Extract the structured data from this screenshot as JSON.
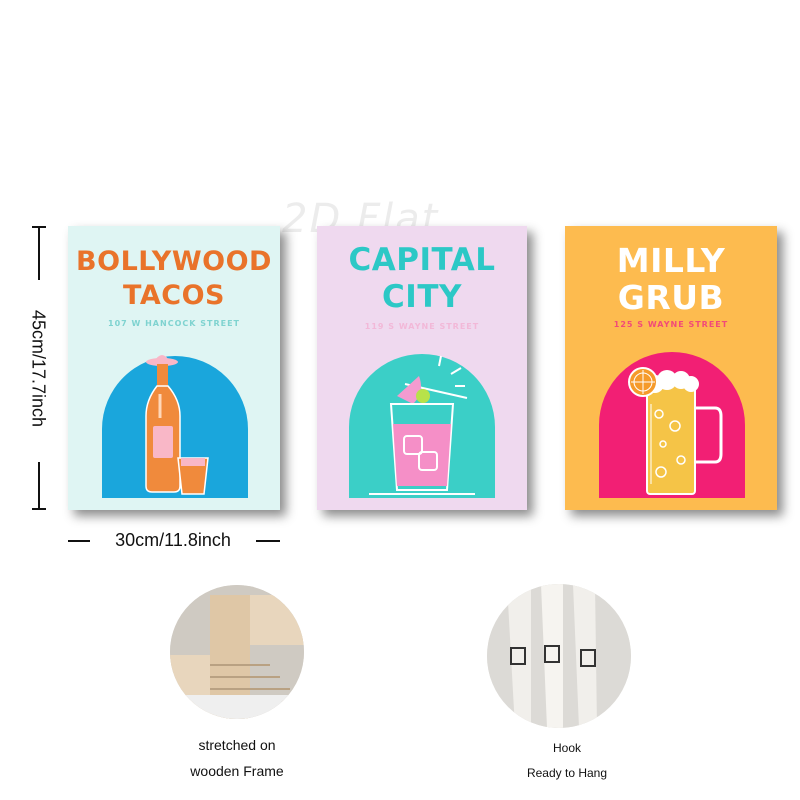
{
  "watermark": "2D Flat",
  "posters": [
    {
      "title_line1": "BOLLYWOOD",
      "title_line2": "TACOS",
      "address": "107 W HANCOCK STREET",
      "background": "#dff5f3",
      "title_color": "#e9732a",
      "address_color": "#7fd3d0",
      "arch_color": "#1aa6dc",
      "drink": "tequila-bottle-and-shot-glass"
    },
    {
      "title_line1": "CAPITAL",
      "title_line2": "CITY",
      "address": "119 S WAYNE STREET",
      "background": "#efd9ef",
      "title_color": "#2cc8c6",
      "address_color": "#f2b8d8",
      "arch_color": "#3bcfc7",
      "drink": "cocktail-glass-with-ice-and-lime"
    },
    {
      "title_line1": "MILLY",
      "title_line2": "GRUB",
      "address": "125 S WAYNE STREET",
      "background": "#fdbb4f",
      "title_color": "#ffffff",
      "address_color": "#f24a78",
      "arch_color": "#f21f74",
      "drink": "beer-mug-with-orange-slice"
    }
  ],
  "dimensions": {
    "height": "45cm/17.7inch",
    "width": "30cm/11.8inch"
  },
  "details": [
    {
      "caption_line1": "stretched on",
      "caption_line2": "wooden Frame",
      "photo": "wooden-frame-corner"
    },
    {
      "caption_line1": "Hook",
      "caption_line2": "Ready to Hang",
      "photo": "sawtooth-hooks"
    }
  ]
}
